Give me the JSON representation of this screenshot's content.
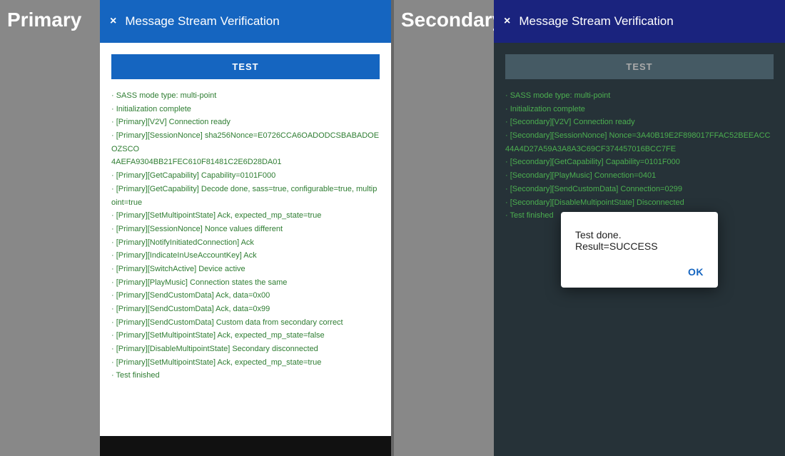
{
  "primary": {
    "label": "Primary",
    "header": {
      "title": "Message Stream Verification",
      "close": "×"
    },
    "test_btn": "TEST",
    "log": "· SASS mode type: multi-point\n· Initialization complete\n· [Primary][V2V] Connection ready\n· [Primary][SessionNonce] sha256Nonce=E0726CCA6OADODCSBABADOEOZSCO\n4AEFA9304BB21FEC610F81481C2E6D28DA01\n· [Primary][GetCapability] Capability=0101F000\n· [Primary][GetCapability] Decode done, sass=true, configurable=true, multipoint=true\n· [Primary][SetMultipointState] Ack, expected_mp_state=true\n· [Primary][SessionNonce] Nonce values different\n· [Primary][NotifyInitiatedConnection] Ack\n· [Primary][IndicateInUseAccountKey] Ack\n· [Primary][SwitchActive] Device active\n· [Primary][PlayMusic] Connection states the same\n· [Primary][SendCustomData] Ack, data=0x00\n· [Primary][SendCustomData] Ack, data=0x99\n· [Primary][SendCustomData] Custom data from secondary correct\n· [Primary][SetMultipointState] Ack, expected_mp_state=false\n· [Primary][DisableMultipointState] Secondary disconnected\n· [Primary][SetMultipointState] Ack, expected_mp_state=true\n· Test finished"
  },
  "secondary": {
    "label": "Secondary",
    "header": {
      "title": "Message Stream Verification",
      "close": "×"
    },
    "test_btn": "TEST",
    "log": "· SASS mode type: multi-point\n· Initialization complete\n· [Secondary][V2V] Connection ready\n· [Secondary][SessionNonce] Nonce=3A40B19E2F898017FFAC52BEEACC44A4D27A59A3A8A3C69CF374457016BCC7FE\n· [Secondary][GetCapability] Capability=0101F000\n· [Secondary][PlayMusic] Connection=0401\n· [Secondary][SendCustomData] Connection=0299\n· [Secondary][DisableMultipointState] Disconnected\n· Test finished",
    "success_dialog": {
      "message": "Test done. Result=SUCCESS",
      "ok_label": "OK"
    }
  }
}
